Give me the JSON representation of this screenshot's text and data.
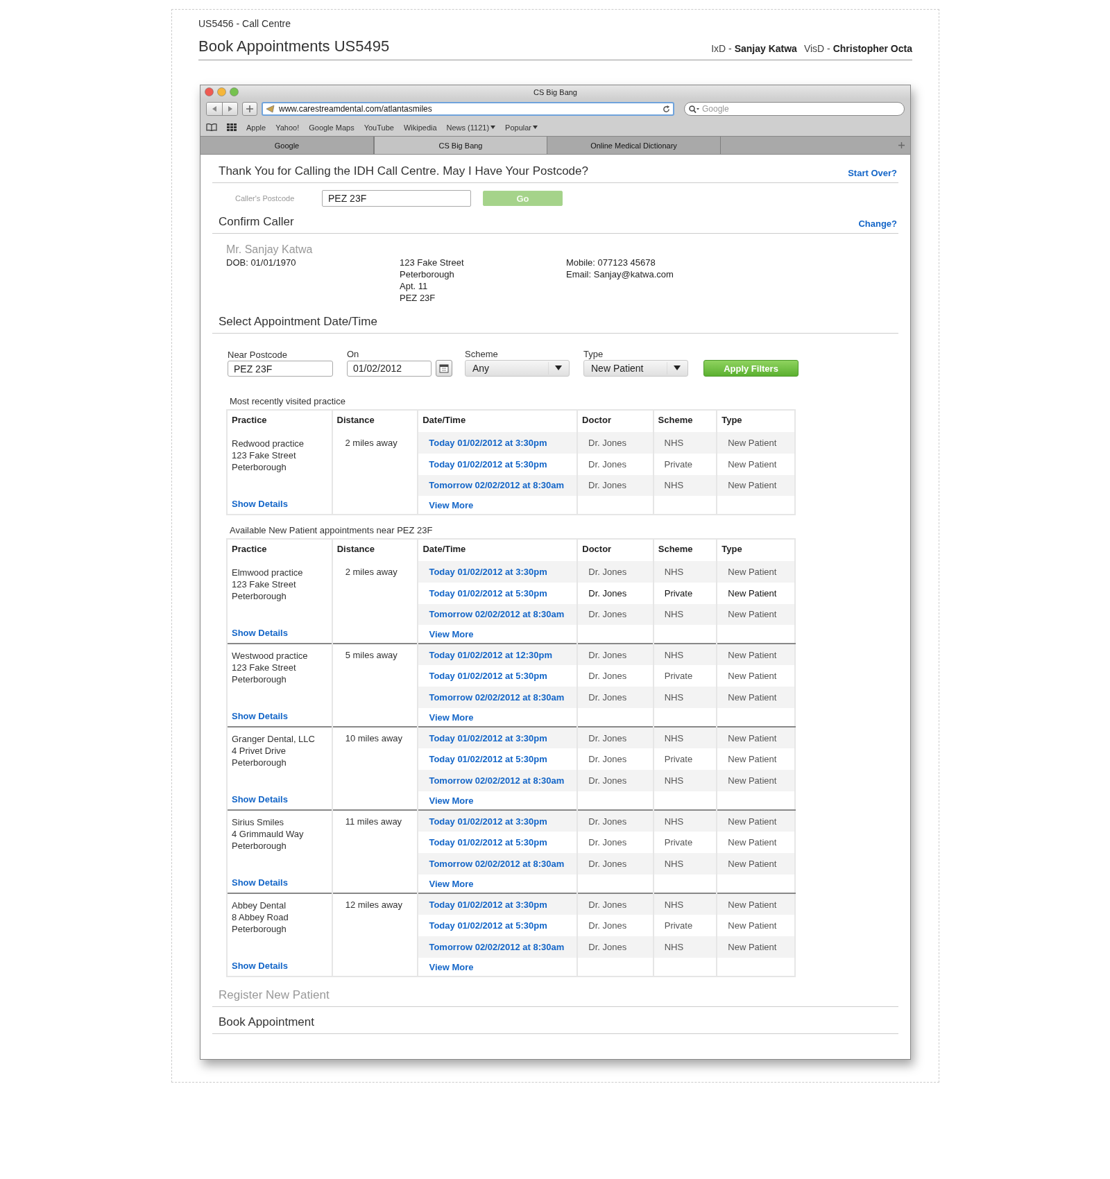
{
  "header": {
    "project": "US5456 - Call Centre",
    "title": "Book Appointments US5495",
    "credits": [
      "IxD - **Sanjay Katwa**",
      "VisD - **Christopher Octa**"
    ]
  },
  "browser": {
    "title": "CS Big Bang",
    "url": "www.carestreamdental.com/atlantasmiles",
    "search_placeholder": "Google",
    "bookmarks": [
      {
        "label": "Apple",
        "menu": false
      },
      {
        "label": "Yahoo!",
        "menu": false
      },
      {
        "label": "Google Maps",
        "menu": false
      },
      {
        "label": "YouTube",
        "menu": false
      },
      {
        "label": "Wikipedia",
        "menu": false
      },
      {
        "label": "News (1121)",
        "menu": true
      },
      {
        "label": "Popular",
        "menu": true
      }
    ],
    "tabs": [
      {
        "label": "Google",
        "selected": false
      },
      {
        "label": "CS Big Bang",
        "selected": true
      },
      {
        "label": "Online Medical Dictionary",
        "selected": false
      }
    ]
  },
  "postcode_section": {
    "heading": "Thank You for Calling the IDH Call Centre. May I Have Your Postcode?",
    "link": "Start Over?",
    "field_label": "Caller's Postcode",
    "value": "PEZ 23F",
    "go": {
      "label": "Go",
      "disabled": true
    }
  },
  "caller_section": {
    "heading": "Confirm Caller",
    "link": "Change?",
    "name": "Mr. Sanjay Katwa",
    "dob": "DOB: 01/01/1970",
    "address": [
      "123 Fake Street",
      "Peterborough",
      "Apt. 11",
      "PEZ 23F"
    ],
    "contact": [
      "Mobile: 077123 45678",
      "Email: Sanjay@katwa.com"
    ]
  },
  "appointment_section": {
    "heading": "Select Appointment Date/Time",
    "filters": [
      {
        "kind": "text",
        "label": "Near Postcode",
        "value": "PEZ 23F"
      },
      {
        "kind": "date",
        "label": "On",
        "value": "01/02/2012"
      },
      {
        "kind": "select",
        "label": "Scheme",
        "value": "Any"
      },
      {
        "kind": "select",
        "label": "Type",
        "value": "New Patient"
      }
    ],
    "apply_button": "Apply Filters",
    "tables": [
      {
        "caption": "Most recently visited practice",
        "columns": [
          "Practice",
          "Distance",
          "Date/Time",
          "Doctor",
          "Scheme",
          "Type"
        ],
        "practices": [
          {
            "name": "Redwood practice",
            "address": [
              "123 Fake Street",
              "Peterborough"
            ],
            "distance": "2 miles away",
            "show_details": "Show Details",
            "view_more": "View More",
            "slots": [
              {
                "datetime": "Today 01/02/2012 at 3:30pm",
                "doctor": "Dr. Jones",
                "scheme": "NHS",
                "type": "New Patient",
                "highlighted": false
              },
              {
                "datetime": "Today 01/02/2012 at 5:30pm",
                "doctor": "Dr. Jones",
                "scheme": "Private",
                "type": "New Patient",
                "highlighted": false
              },
              {
                "datetime": "Tomorrow 02/02/2012 at 8:30am",
                "doctor": "Dr. Jones",
                "scheme": "NHS",
                "type": "New Patient",
                "highlighted": false
              }
            ]
          }
        ]
      },
      {
        "caption": "Available New Patient appointments near PEZ 23F",
        "columns": [
          "Practice",
          "Distance",
          "Date/Time",
          "Doctor",
          "Scheme",
          "Type"
        ],
        "practices": [
          {
            "name": "Elmwood practice",
            "address": [
              "123 Fake Street",
              "Peterborough"
            ],
            "distance": "2 miles away",
            "show_details": "Show Details",
            "view_more": "View More",
            "slots": [
              {
                "datetime": "Today 01/02/2012 at 3:30pm",
                "doctor": "Dr. Jones",
                "scheme": "NHS",
                "type": "New Patient",
                "highlighted": false
              },
              {
                "datetime": "Today 01/02/2012 at 5:30pm",
                "doctor": "Dr. Jones",
                "scheme": "Private",
                "type": "New Patient",
                "highlighted": true
              },
              {
                "datetime": "Tomorrow 02/02/2012 at 8:30am",
                "doctor": "Dr. Jones",
                "scheme": "NHS",
                "type": "New Patient",
                "highlighted": false
              }
            ]
          },
          {
            "name": "Westwood practice",
            "address": [
              "123 Fake Street",
              "Peterborough"
            ],
            "distance": "5 miles away",
            "show_details": "Show Details",
            "view_more": "View More",
            "slots": [
              {
                "datetime": "Today 01/02/2012 at 12:30pm",
                "doctor": "Dr. Jones",
                "scheme": "NHS",
                "type": "New Patient",
                "highlighted": false
              },
              {
                "datetime": "Today 01/02/2012 at 5:30pm",
                "doctor": "Dr. Jones",
                "scheme": "Private",
                "type": "New Patient",
                "highlighted": false
              },
              {
                "datetime": "Tomorrow 02/02/2012 at 8:30am",
                "doctor": "Dr. Jones",
                "scheme": "NHS",
                "type": "New Patient",
                "highlighted": false
              }
            ]
          },
          {
            "name": "Granger Dental, LLC",
            "address": [
              "4 Privet Drive",
              "Peterborough"
            ],
            "distance": "10 miles away",
            "show_details": "Show Details",
            "view_more": "View More",
            "slots": [
              {
                "datetime": "Today 01/02/2012 at 3:30pm",
                "doctor": "Dr. Jones",
                "scheme": "NHS",
                "type": "New Patient",
                "highlighted": false
              },
              {
                "datetime": "Today 01/02/2012 at 5:30pm",
                "doctor": "Dr. Jones",
                "scheme": "Private",
                "type": "New Patient",
                "highlighted": false
              },
              {
                "datetime": "Tomorrow 02/02/2012 at 8:30am",
                "doctor": "Dr. Jones",
                "scheme": "NHS",
                "type": "New Patient",
                "highlighted": false
              }
            ]
          },
          {
            "name": "Sirius Smiles",
            "address": [
              "4 Grimmauld Way",
              "Peterborough"
            ],
            "distance": "11 miles away",
            "show_details": "Show Details",
            "view_more": "View More",
            "slots": [
              {
                "datetime": "Today 01/02/2012 at 3:30pm",
                "doctor": "Dr. Jones",
                "scheme": "NHS",
                "type": "New Patient",
                "highlighted": false
              },
              {
                "datetime": "Today 01/02/2012 at 5:30pm",
                "doctor": "Dr. Jones",
                "scheme": "Private",
                "type": "New Patient",
                "highlighted": false
              },
              {
                "datetime": "Tomorrow 02/02/2012 at 8:30am",
                "doctor": "Dr. Jones",
                "scheme": "NHS",
                "type": "New Patient",
                "highlighted": false
              }
            ]
          },
          {
            "name": "Abbey Dental",
            "address": [
              "8 Abbey Road",
              "Peterborough"
            ],
            "distance": "12 miles away",
            "show_details": "Show Details",
            "view_more": "View More",
            "slots": [
              {
                "datetime": "Today 01/02/2012 at 3:30pm",
                "doctor": "Dr. Jones",
                "scheme": "NHS",
                "type": "New Patient",
                "highlighted": false
              },
              {
                "datetime": "Today 01/02/2012 at 5:30pm",
                "doctor": "Dr. Jones",
                "scheme": "Private",
                "type": "New Patient",
                "highlighted": false
              },
              {
                "datetime": "Tomorrow 02/02/2012 at 8:30am",
                "doctor": "Dr. Jones",
                "scheme": "NHS",
                "type": "New Patient",
                "highlighted": false
              }
            ]
          }
        ]
      }
    ]
  },
  "footer_sections": [
    {
      "heading": "Register New Patient",
      "disabled": true
    },
    {
      "heading": "Book Appointment",
      "disabled": false
    }
  ]
}
